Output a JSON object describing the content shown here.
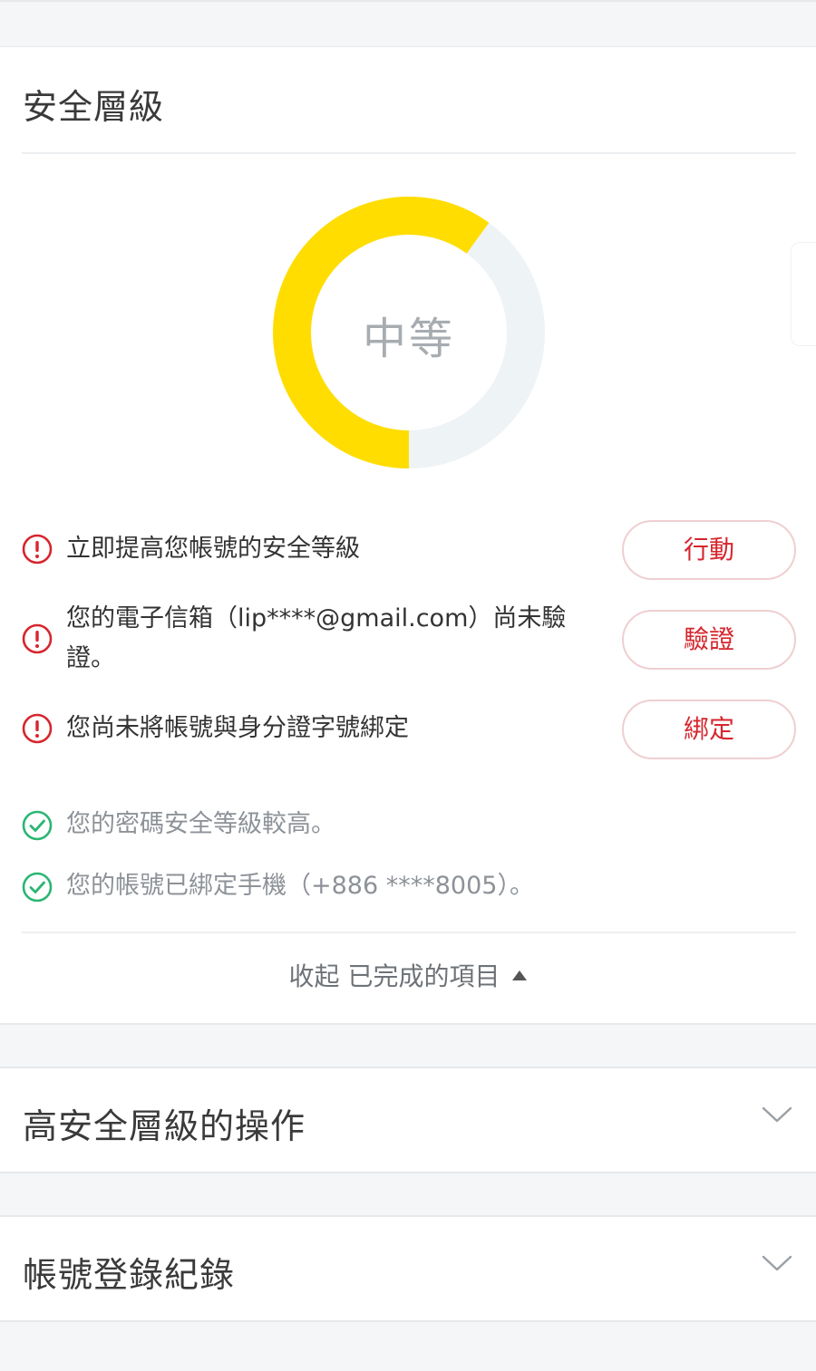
{
  "security": {
    "title": "安全層級",
    "level_label": "中等",
    "level_fraction": 0.6,
    "colors": {
      "filled": "#ffdd00",
      "empty": "#eef3f5",
      "warning": "#d6262e",
      "ok": "#2bb673"
    },
    "issues": [
      {
        "icon": "warning-icon",
        "text": "立即提高您帳號的安全等級",
        "action": "行動"
      },
      {
        "icon": "warning-icon",
        "text": "您的電子信箱（lip****@gmail.com）尚未驗證。",
        "action": "驗證"
      },
      {
        "icon": "warning-icon",
        "text": "您尚未將帳號與身分證字號綁定",
        "action": "綁定"
      }
    ],
    "completed": [
      {
        "icon": "check-circle-icon",
        "text": "您的密碼安全等級較高。"
      },
      {
        "icon": "check-circle-icon",
        "text": "您的帳號已綁定手機（+886 ****8005）。"
      }
    ],
    "collapse_label": "收起 已完成的項目"
  },
  "sections": [
    {
      "title": "高安全層級的操作",
      "icon": "chevron-down-icon"
    },
    {
      "title": "帳號登錄紀錄",
      "icon": "chevron-down-icon"
    }
  ]
}
